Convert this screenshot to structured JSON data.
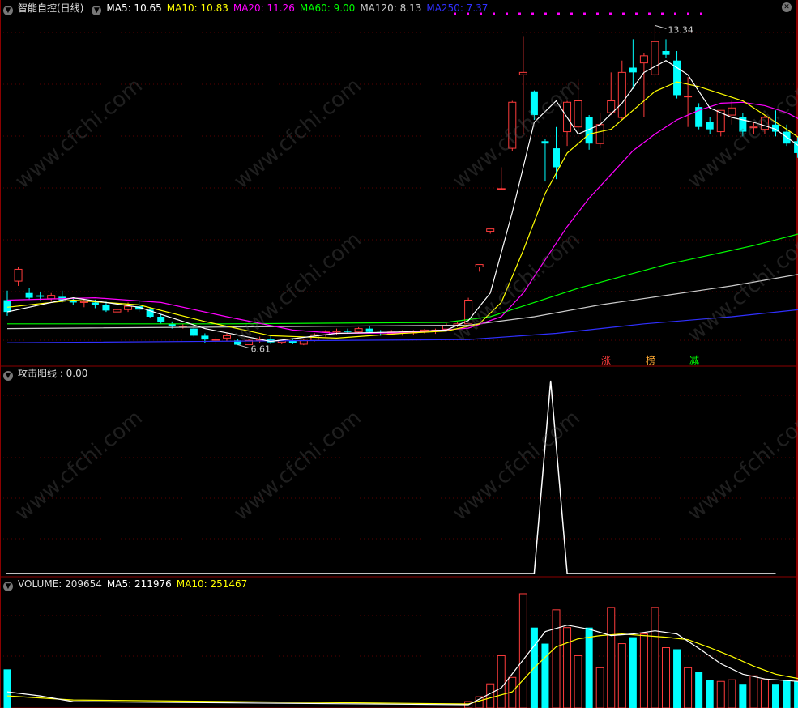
{
  "main": {
    "title": "智能自控(日线)",
    "ma5": "MA5: 10.65",
    "ma10": "MA10: 10.83",
    "ma20": "MA20: 11.26",
    "ma60": "MA60: 9.00",
    "ma120": "MA120: 8.13",
    "ma250": "MA250: 7.37",
    "high_label": "13.34",
    "low_label": "6.61",
    "tags": [
      "涨",
      "榜",
      "减"
    ]
  },
  "indicator": {
    "label": "攻击阳线 : 0.00"
  },
  "volume": {
    "label": "VOLUME: 209654",
    "ma5": "MA5: 211976",
    "ma10": "MA10: 251467"
  },
  "watermark": "www.cfchi.com",
  "colors": {
    "up": "#ff3c3c",
    "down": "#00ffff",
    "ma5": "#ffffff",
    "ma10": "#ffff00",
    "ma20": "#ff00ff",
    "ma60": "#00ff00",
    "ma120": "#cccccc",
    "ma250": "#3030ff"
  },
  "chart_data": {
    "type": "candlestick",
    "ohlc": [
      [
        7.55,
        7.75,
        7.22,
        7.3
      ],
      [
        7.95,
        8.25,
        7.85,
        8.2
      ],
      [
        7.7,
        7.8,
        7.55,
        7.6
      ],
      [
        7.65,
        7.72,
        7.55,
        7.62
      ],
      [
        7.58,
        7.7,
        7.52,
        7.65
      ],
      [
        7.62,
        7.75,
        7.5,
        7.55
      ],
      [
        7.55,
        7.6,
        7.45,
        7.5
      ],
      [
        7.5,
        7.58,
        7.4,
        7.52
      ],
      [
        7.5,
        7.56,
        7.38,
        7.45
      ],
      [
        7.45,
        7.52,
        7.3,
        7.33
      ],
      [
        7.3,
        7.4,
        7.2,
        7.35
      ],
      [
        7.35,
        7.5,
        7.3,
        7.42
      ],
      [
        7.42,
        7.55,
        7.3,
        7.35
      ],
      [
        7.35,
        7.4,
        7.18,
        7.2
      ],
      [
        7.2,
        7.25,
        7.05,
        7.08
      ],
      [
        7.05,
        7.1,
        6.95,
        7.0
      ],
      [
        7.0,
        7.05,
        6.95,
        7.0
      ],
      [
        6.95,
        7.02,
        6.78,
        6.8
      ],
      [
        6.8,
        6.85,
        6.65,
        6.72
      ],
      [
        6.72,
        6.78,
        6.62,
        6.72
      ],
      [
        6.75,
        6.85,
        6.68,
        6.8
      ],
      [
        6.7,
        6.72,
        6.6,
        6.61
      ],
      [
        6.61,
        6.72,
        6.61,
        6.7
      ],
      [
        6.7,
        6.78,
        6.65,
        6.72
      ],
      [
        6.72,
        6.8,
        6.62,
        6.66
      ],
      [
        6.66,
        6.7,
        6.62,
        6.7
      ],
      [
        6.7,
        6.72,
        6.62,
        6.65
      ],
      [
        6.62,
        6.72,
        6.6,
        6.7
      ],
      [
        6.7,
        6.85,
        6.68,
        6.82
      ],
      [
        6.82,
        6.92,
        6.78,
        6.88
      ],
      [
        6.88,
        6.95,
        6.82,
        6.9
      ],
      [
        6.9,
        6.95,
        6.85,
        6.88
      ],
      [
        6.88,
        6.98,
        6.86,
        6.95
      ],
      [
        6.95,
        7.0,
        6.85,
        6.88
      ],
      [
        6.88,
        6.92,
        6.8,
        6.85
      ],
      [
        6.84,
        6.92,
        6.82,
        6.88
      ],
      [
        6.86,
        6.92,
        6.8,
        6.88
      ],
      [
        6.86,
        6.92,
        6.82,
        6.88
      ],
      [
        6.88,
        6.94,
        6.85,
        6.92
      ],
      [
        6.9,
        6.95,
        6.84,
        6.92
      ],
      [
        6.94,
        7.06,
        6.9,
        7.02
      ],
      [
        7.02,
        7.08,
        6.98,
        7.05
      ],
      [
        7.05,
        7.6,
        7.05,
        7.55
      ],
      [
        8.25,
        8.3,
        8.15,
        8.3
      ],
      [
        9.0,
        9.05,
        8.95,
        9.05
      ],
      [
        9.9,
        10.35,
        9.9,
        9.9
      ],
      [
        10.75,
        11.75,
        10.7,
        11.72
      ],
      [
        12.3,
        13.1,
        11.05,
        12.35
      ],
      [
        11.95,
        11.97,
        11.35,
        11.45
      ],
      [
        10.9,
        10.95,
        10.05,
        10.85
      ],
      [
        10.75,
        11.2,
        10.1,
        10.35
      ],
      [
        11.1,
        11.75,
        10.8,
        11.72
      ],
      [
        11.2,
        12.2,
        11.1,
        11.75
      ],
      [
        11.4,
        11.45,
        10.72,
        10.85
      ],
      [
        10.85,
        11.5,
        10.75,
        11.25
      ],
      [
        11.5,
        12.35,
        11.45,
        11.75
      ],
      [
        11.4,
        12.6,
        11.35,
        12.35
      ],
      [
        12.45,
        13.05,
        12.0,
        12.35
      ],
      [
        12.55,
        12.75,
        11.4,
        12.7
      ],
      [
        12.3,
        13.34,
        12.25,
        13.0
      ],
      [
        12.8,
        13.05,
        12.65,
        12.72
      ],
      [
        12.6,
        12.8,
        11.8,
        11.87
      ],
      [
        11.85,
        12.25,
        11.2,
        11.85
      ],
      [
        11.62,
        11.7,
        11.15,
        11.2
      ],
      [
        11.3,
        11.4,
        11.05,
        11.15
      ],
      [
        11.1,
        11.55,
        11.0,
        11.55
      ],
      [
        11.45,
        11.75,
        11.25,
        11.6
      ],
      [
        11.4,
        11.5,
        11.0,
        11.1
      ],
      [
        11.2,
        11.3,
        11.05,
        11.2
      ],
      [
        11.15,
        11.45,
        11.05,
        11.4
      ],
      [
        11.25,
        11.55,
        11.0,
        11.1
      ],
      [
        11.1,
        11.25,
        10.8,
        10.85
      ],
      [
        10.9,
        11.0,
        10.55,
        10.65
      ],
      [
        10.55,
        10.8,
        10.45,
        10.7
      ]
    ],
    "high_mark": 13.34,
    "low_mark": 6.61,
    "ma5_samples": [
      [
        0,
        7.3
      ],
      [
        6,
        7.6
      ],
      [
        12,
        7.4
      ],
      [
        18,
        6.95
      ],
      [
        24,
        6.68
      ],
      [
        30,
        6.85
      ],
      [
        36,
        6.88
      ],
      [
        40,
        6.92
      ],
      [
        42,
        7.12
      ],
      [
        44,
        7.7
      ],
      [
        46,
        9.4
      ],
      [
        48,
        11.3
      ],
      [
        50,
        11.75
      ],
      [
        52,
        11.05
      ],
      [
        54,
        11.25
      ],
      [
        56,
        11.7
      ],
      [
        58,
        12.35
      ],
      [
        60,
        12.6
      ],
      [
        62,
        12.3
      ],
      [
        64,
        11.6
      ],
      [
        66,
        11.4
      ],
      [
        68,
        11.3
      ],
      [
        70,
        11.15
      ],
      [
        73,
        10.65
      ]
    ],
    "ma10_samples": [
      [
        0,
        7.4
      ],
      [
        6,
        7.55
      ],
      [
        12,
        7.45
      ],
      [
        18,
        7.1
      ],
      [
        24,
        6.8
      ],
      [
        30,
        6.75
      ],
      [
        36,
        6.85
      ],
      [
        40,
        6.9
      ],
      [
        43,
        7.05
      ],
      [
        45,
        7.5
      ],
      [
        47,
        8.6
      ],
      [
        49,
        9.8
      ],
      [
        51,
        10.65
      ],
      [
        53,
        11.05
      ],
      [
        55,
        11.15
      ],
      [
        57,
        11.55
      ],
      [
        59,
        11.95
      ],
      [
        61,
        12.15
      ],
      [
        63,
        12.05
      ],
      [
        65,
        11.9
      ],
      [
        67,
        11.75
      ],
      [
        69,
        11.45
      ],
      [
        71,
        11.15
      ],
      [
        73,
        10.83
      ]
    ],
    "ma20_samples": [
      [
        0,
        7.55
      ],
      [
        8,
        7.6
      ],
      [
        14,
        7.5
      ],
      [
        20,
        7.2
      ],
      [
        26,
        6.92
      ],
      [
        30,
        6.85
      ],
      [
        36,
        6.86
      ],
      [
        42,
        6.96
      ],
      [
        45,
        7.2
      ],
      [
        47,
        7.7
      ],
      [
        49,
        8.4
      ],
      [
        51,
        9.1
      ],
      [
        53,
        9.7
      ],
      [
        55,
        10.2
      ],
      [
        57,
        10.7
      ],
      [
        59,
        11.05
      ],
      [
        61,
        11.35
      ],
      [
        63,
        11.55
      ],
      [
        65,
        11.7
      ],
      [
        67,
        11.72
      ],
      [
        69,
        11.65
      ],
      [
        71,
        11.5
      ],
      [
        73,
        11.26
      ]
    ],
    "ma60_samples": [
      [
        0,
        7.05
      ],
      [
        20,
        7.05
      ],
      [
        40,
        7.08
      ],
      [
        44,
        7.2
      ],
      [
        48,
        7.5
      ],
      [
        52,
        7.8
      ],
      [
        56,
        8.05
      ],
      [
        60,
        8.3
      ],
      [
        64,
        8.5
      ],
      [
        68,
        8.7
      ],
      [
        73,
        9.0
      ]
    ],
    "ma120_samples": [
      [
        0,
        6.95
      ],
      [
        30,
        7.0
      ],
      [
        42,
        7.02
      ],
      [
        48,
        7.2
      ],
      [
        54,
        7.45
      ],
      [
        60,
        7.65
      ],
      [
        66,
        7.85
      ],
      [
        73,
        8.13
      ]
    ],
    "ma250_samples": [
      [
        0,
        6.65
      ],
      [
        42,
        6.72
      ],
      [
        50,
        6.85
      ],
      [
        58,
        7.05
      ],
      [
        66,
        7.2
      ],
      [
        73,
        7.37
      ]
    ],
    "indicator_series": [
      [
        0,
        0
      ],
      [
        48,
        0
      ],
      [
        49.5,
        1
      ],
      [
        51,
        0
      ],
      [
        70,
        0
      ]
    ],
    "volume_bars": [
      48000,
      0,
      0,
      0,
      0,
      0,
      0,
      0,
      0,
      0,
      0,
      0,
      0,
      0,
      0,
      0,
      0,
      0,
      0,
      0,
      0,
      0,
      0,
      0,
      0,
      0,
      0,
      0,
      0,
      0,
      0,
      0,
      0,
      0,
      0,
      0,
      0,
      0,
      0,
      0,
      0,
      0,
      8000,
      14000,
      30000,
      65000,
      38000,
      142000,
      100000,
      80000,
      122000,
      100000,
      65000,
      100000,
      50000,
      125000,
      80000,
      88000,
      92000,
      125000,
      75000,
      73000,
      50000,
      45000,
      35000,
      33000,
      35000,
      30000,
      40000,
      35000,
      30000,
      35000,
      33000,
      35000
    ],
    "volume_colors_up": [
      false,
      true,
      false,
      false,
      false,
      false,
      false,
      false,
      false,
      false,
      false,
      false,
      false,
      false,
      false,
      false,
      false,
      false,
      false,
      false,
      false,
      false,
      false,
      false,
      false,
      false,
      false,
      false,
      false,
      false,
      false,
      false,
      false,
      false,
      false,
      false,
      false,
      false,
      false,
      false,
      true,
      true,
      true,
      true,
      true,
      true,
      true,
      true,
      false,
      false,
      true,
      true,
      true,
      false,
      true,
      true,
      true,
      false,
      true,
      true,
      true,
      false,
      true,
      false,
      false,
      true,
      true,
      false,
      true,
      true,
      false,
      false,
      false,
      true
    ],
    "vol_ma5_samples": [
      [
        0,
        20000
      ],
      [
        3,
        15000
      ],
      [
        6,
        8000
      ],
      [
        42,
        4000
      ],
      [
        45,
        25000
      ],
      [
        47,
        60000
      ],
      [
        49,
        95000
      ],
      [
        51,
        103000
      ],
      [
        53,
        98000
      ],
      [
        55,
        90000
      ],
      [
        57,
        92000
      ],
      [
        59,
        96000
      ],
      [
        61,
        92000
      ],
      [
        63,
        74000
      ],
      [
        65,
        55000
      ],
      [
        67,
        42000
      ],
      [
        69,
        36000
      ],
      [
        71,
        34000
      ],
      [
        73,
        32000
      ]
    ],
    "vol_ma10_samples": [
      [
        0,
        15000
      ],
      [
        6,
        10000
      ],
      [
        42,
        5000
      ],
      [
        46,
        20000
      ],
      [
        48,
        50000
      ],
      [
        50,
        76000
      ],
      [
        52,
        86000
      ],
      [
        54,
        90000
      ],
      [
        56,
        92000
      ],
      [
        58,
        90000
      ],
      [
        60,
        88000
      ],
      [
        62,
        85000
      ],
      [
        64,
        75000
      ],
      [
        66,
        64000
      ],
      [
        68,
        52000
      ],
      [
        70,
        42000
      ],
      [
        73,
        34000
      ]
    ]
  }
}
